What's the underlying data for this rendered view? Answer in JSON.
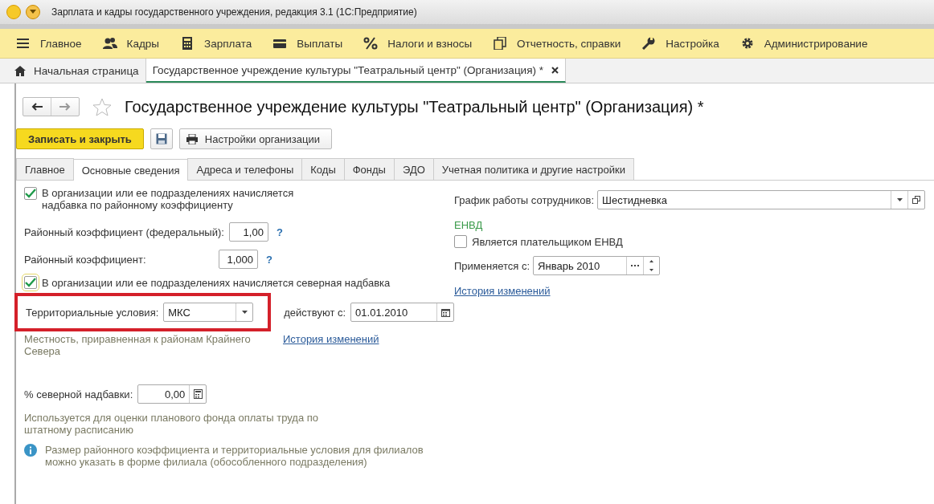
{
  "window": {
    "title": "Зарплата и кадры государственного учреждения, редакция 3.1  (1С:Предприятие)"
  },
  "sections_menu": [
    "Главное",
    "Кадры",
    "Зарплата",
    "Выплаты",
    "Налоги и взносы",
    "Отчетность, справки",
    "Настройка",
    "Администрирование"
  ],
  "open_tabs": [
    {
      "label": "Начальная страница",
      "selected": false
    },
    {
      "label": "Государственное учреждение культуры \"Театральный центр\" (Организация) *",
      "selected": true
    }
  ],
  "form": {
    "title": "Государственное учреждение культуры \"Театральный центр\" (Организация) *",
    "save_close": "Записать и закрыть",
    "settings": "Настройки организации",
    "tabs": [
      {
        "label": "Главное",
        "selected": false
      },
      {
        "label": "Основные сведения",
        "selected": true
      },
      {
        "label": "Адреса и телефоны",
        "selected": false
      },
      {
        "label": "Коды",
        "selected": false
      },
      {
        "label": "Фонды",
        "selected": false
      },
      {
        "label": "ЭДО",
        "selected": false
      },
      {
        "label": "Учетная политика и другие настройки",
        "selected": false
      }
    ],
    "left": {
      "district_allowance": {
        "label": "В организации или ее подразделениях начисляется надбавка по районному коэффициенту",
        "checked": true
      },
      "coefficients": [
        {
          "label": "Районный коэффициент (федеральный):",
          "value": "1,00",
          "help": "?"
        },
        {
          "label": "Районный коэффициент:",
          "value": "1,000",
          "help": "?"
        }
      ],
      "north_allowance": {
        "label": "В организации или ее подразделениях начисляется северная надбавка",
        "checked": true
      },
      "territorial": {
        "label": "Территориальные условия:",
        "value": "МКС",
        "highlighted": true
      },
      "valid_from": {
        "label": "действуют с:",
        "value": "01.01.2010"
      },
      "territorial_hint": "Местность, приравненная к районам Крайнего Севера",
      "history_link": "История изменений",
      "north_percent": {
        "label": "% северной надбавки:",
        "value": "0,00"
      },
      "north_percent_hint": "Используется для оценки планового фонда оплаты труда по штатному расписанию",
      "info": "Размер районного коэффициента и территориальные условия для филиалов можно указать в форме филиала (обособленного подразделения)"
    },
    "right": {
      "schedule": {
        "label": "График работы сотрудников:",
        "value": "Шестидневка"
      },
      "envd_heading": "ЕНВД",
      "envd_payer": {
        "label": "Является плательщиком ЕНВД",
        "checked": false
      },
      "applies_from": {
        "label": "Применяется с:",
        "value": "Январь 2010"
      },
      "history_link": "История изменений"
    }
  }
}
